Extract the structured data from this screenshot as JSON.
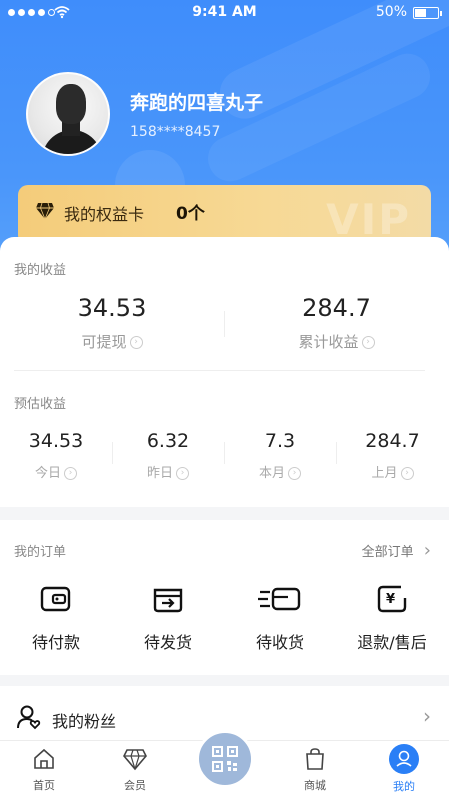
{
  "status_bar": {
    "time": "9:41 AM",
    "battery": "50%"
  },
  "profile": {
    "name": "奔跑的四喜丸子",
    "phone": "158****8457"
  },
  "vip_card": {
    "label": "我的权益卡",
    "count": "0个",
    "watermark": "VIP"
  },
  "earnings": {
    "title": "我的收益",
    "withdrawable_value": "34.53",
    "withdrawable_label": "可提现",
    "total_value": "284.7",
    "total_label": "累计收益"
  },
  "estimated": {
    "title": "预估收益",
    "items": [
      {
        "value": "34.53",
        "label": "今日"
      },
      {
        "value": "6.32",
        "label": "昨日"
      },
      {
        "value": "7.3",
        "label": "本月"
      },
      {
        "value": "284.7",
        "label": "上月"
      }
    ]
  },
  "orders": {
    "title": "我的订单",
    "all_label": "全部订单",
    "items": [
      {
        "label": "待付款",
        "icon": "wallet-icon"
      },
      {
        "label": "待发货",
        "icon": "ship-box-icon"
      },
      {
        "label": "待收货",
        "icon": "delivery-icon"
      },
      {
        "label": "退款/售后",
        "icon": "refund-icon"
      }
    ]
  },
  "fans": {
    "label": "我的粉丝",
    "icon": "user-heart-icon"
  },
  "tabbar": {
    "items": [
      {
        "label": "首页",
        "icon": "home-icon"
      },
      {
        "label": "会员",
        "icon": "diamond-icon"
      },
      {
        "label": "商城",
        "icon": "shopping-bag-icon"
      },
      {
        "label": "我的",
        "icon": "profile-icon"
      }
    ],
    "center_icon": "qr-code-icon",
    "active_color": "#2a7ff6"
  },
  "colors": {
    "header_blue": "#4a96fa",
    "vip_gold": "#f4cc7a"
  }
}
